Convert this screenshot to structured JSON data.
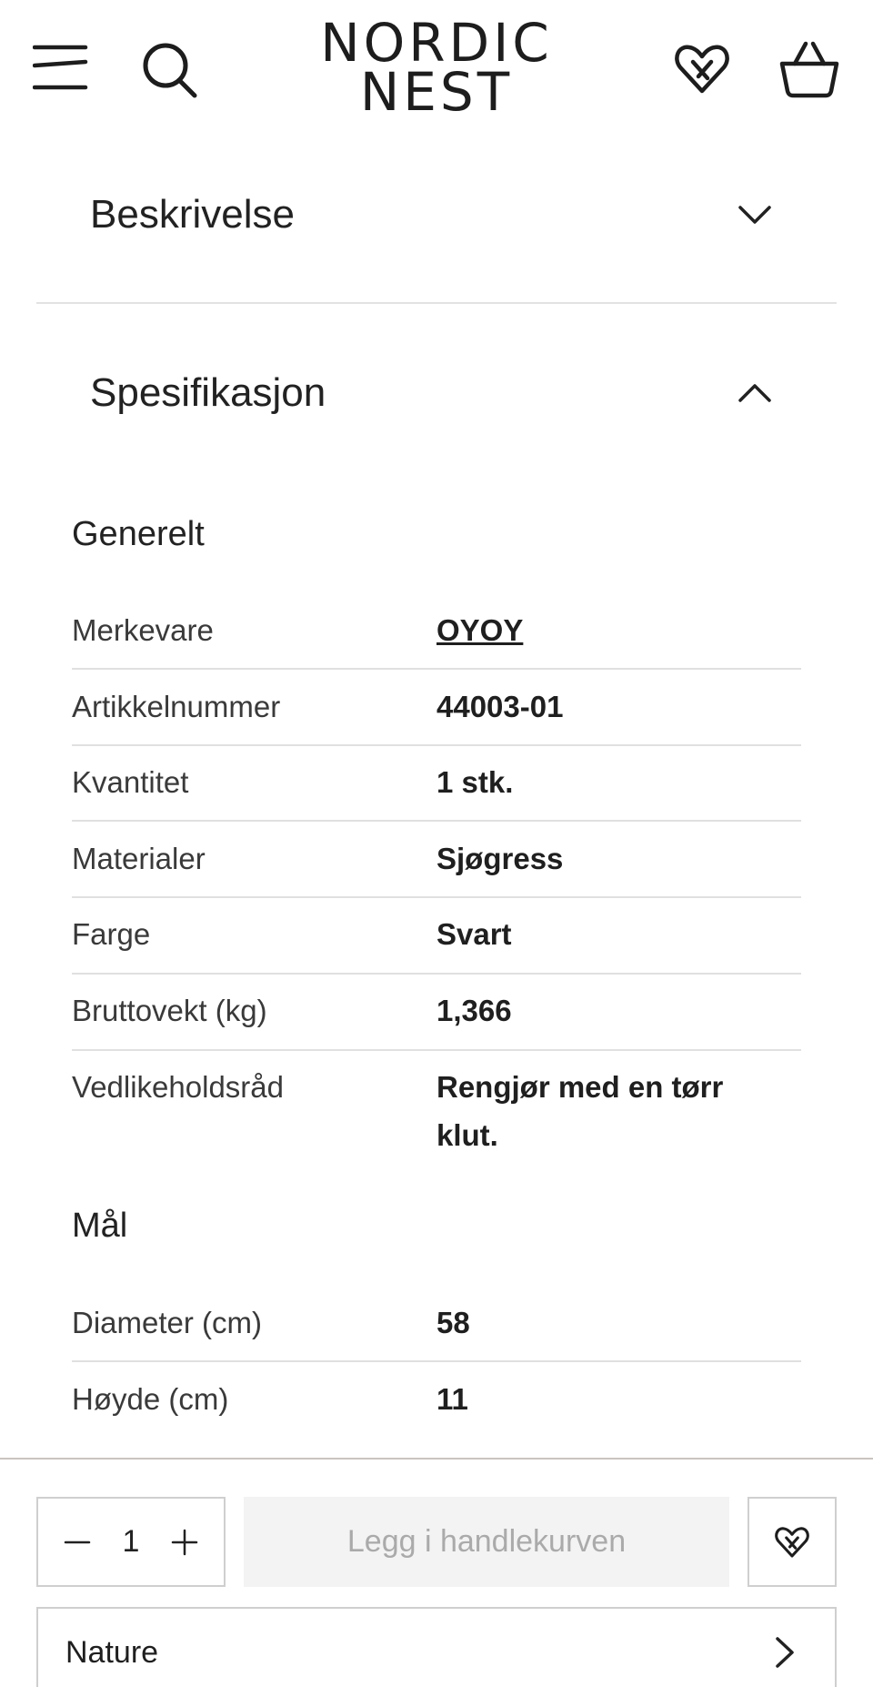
{
  "header": {
    "logo_line1": "NORDIC",
    "logo_line2": "NEST",
    "icons": [
      "menu-icon",
      "search-icon",
      "heart-icon",
      "basket-icon"
    ]
  },
  "accordions": {
    "description_label": "Beskrivelse",
    "specification_label": "Spesifikasjon"
  },
  "spec": {
    "general_title": "Generelt",
    "general_rows": [
      {
        "label": "Merkevare",
        "value": "OYOY"
      },
      {
        "label": "Artikkelnummer",
        "value": "44003-01"
      },
      {
        "label": "Kvantitet",
        "value": "1 stk."
      },
      {
        "label": "Materialer",
        "value": "Sjøgress"
      },
      {
        "label": "Farge",
        "value": "Svart"
      },
      {
        "label": "Bruttovekt (kg)",
        "value": "1,366"
      },
      {
        "label": "Vedlikeholdsråd",
        "value": "Rengjør med en tørr klut."
      }
    ],
    "dimensions_title": "Mål",
    "dimension_rows": [
      {
        "label": "Diameter (cm)",
        "value": "58"
      },
      {
        "label": "Høyde (cm)",
        "value": "11"
      }
    ]
  },
  "bottom_bar": {
    "quantity": "1",
    "add_to_cart_label": "Legg i handlekurven",
    "nature_label": "Nature"
  },
  "colors": {
    "text": "#222222",
    "divider": "#e2e2e2",
    "disabled_button_bg": "#f3f3f3",
    "disabled_button_text": "#aaaaaa"
  }
}
